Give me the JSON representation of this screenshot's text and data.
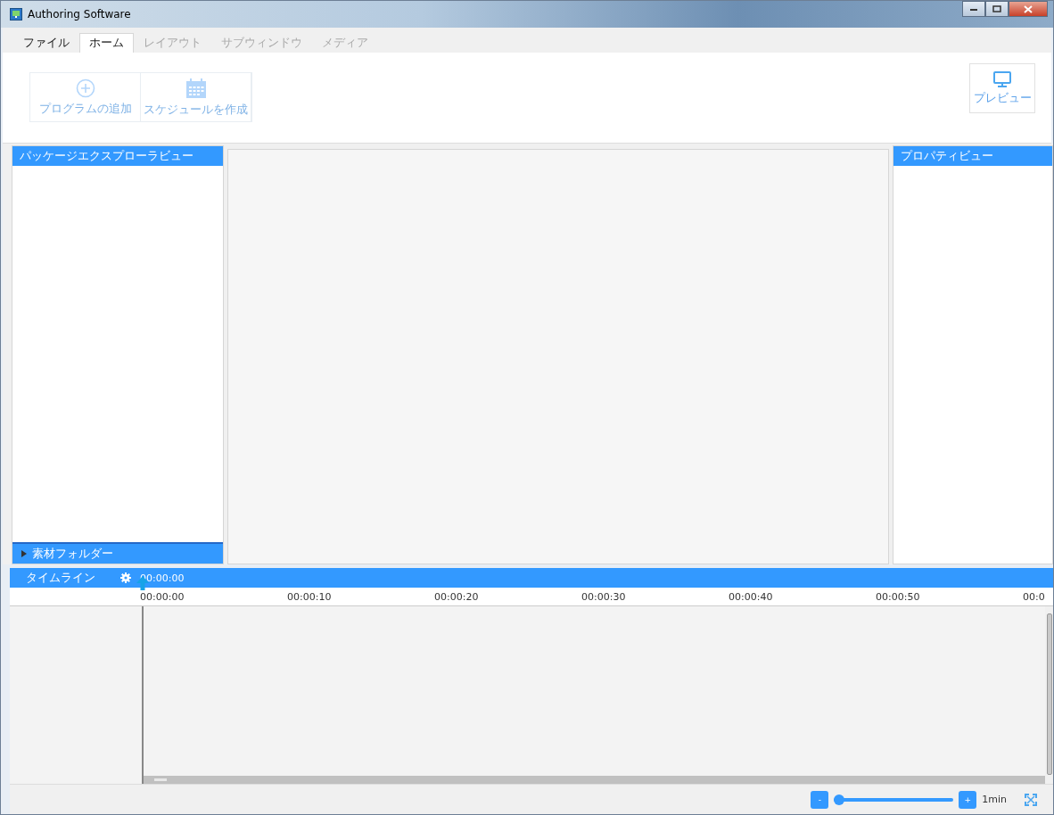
{
  "window": {
    "title": "Authoring Software"
  },
  "tabs": [
    {
      "label": "ファイル",
      "selected": false,
      "disabled": false
    },
    {
      "label": "ホーム",
      "selected": true,
      "disabled": false
    },
    {
      "label": "レイアウト",
      "selected": false,
      "disabled": true
    },
    {
      "label": "サブウィンドウ",
      "selected": false,
      "disabled": true
    },
    {
      "label": "メディア",
      "selected": false,
      "disabled": true
    }
  ],
  "ribbon": {
    "buttons": [
      {
        "kind": "add",
        "label": "プログラムの追加",
        "disabled": true
      },
      {
        "kind": "calendar",
        "label": "スケジュールを作成",
        "disabled": true
      }
    ],
    "preview_button": {
      "label": "プレビュー",
      "disabled": true
    }
  },
  "package_explorer": {
    "title": "パッケージエクスプローラビュー",
    "folder": {
      "label": "素材フォルダー",
      "expanded": false
    }
  },
  "property_view": {
    "title": "プロパティビュー"
  },
  "timeline": {
    "title": "タイムライン",
    "current_time": "00:00:00",
    "ruler": [
      "00:00:00",
      "00:00:10",
      "00:00:20",
      "00:00:30",
      "00:00:40",
      "00:00:50",
      "00:0"
    ],
    "zoom": {
      "minus": "-",
      "plus": "+",
      "level": 0,
      "unit": "1min"
    }
  }
}
